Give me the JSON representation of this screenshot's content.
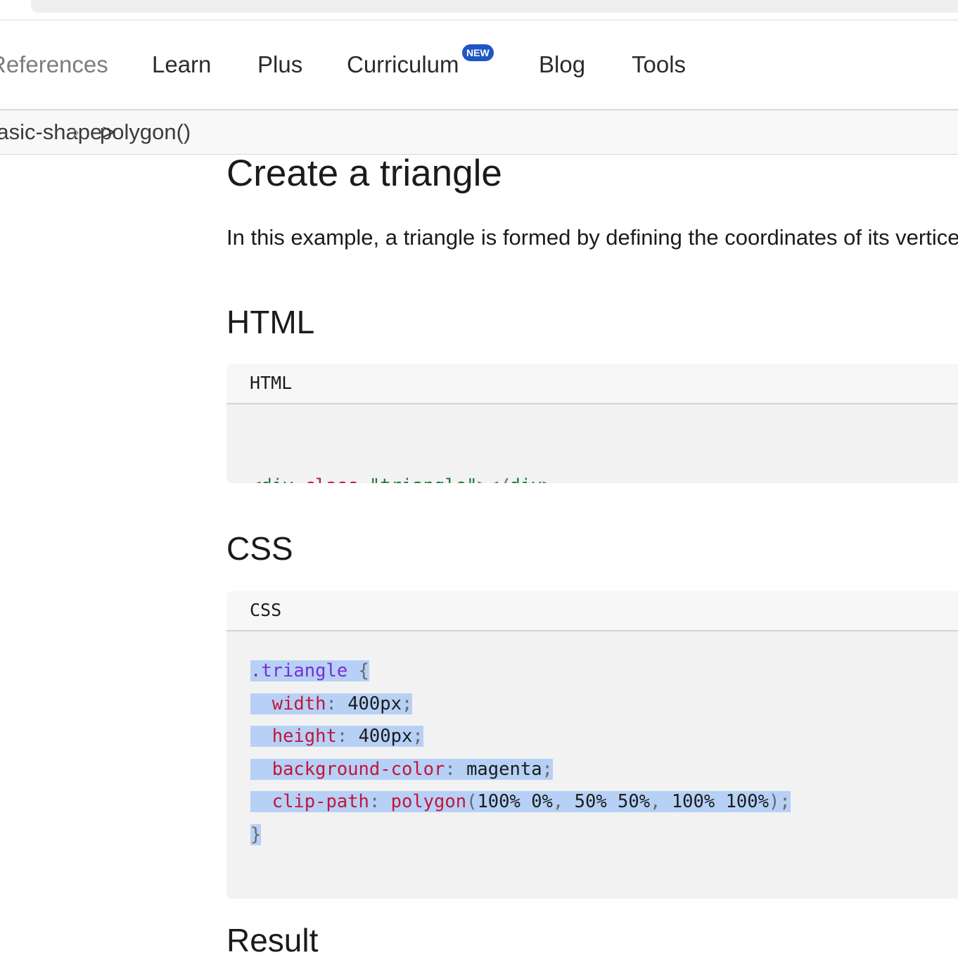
{
  "address_bar": {},
  "nav": {
    "items": [
      "References",
      "Learn",
      "Plus",
      "Curriculum",
      "Blog",
      "Tools"
    ],
    "curriculum_badge": "NEW"
  },
  "breadcrumb": {
    "parent": "<basic-shape>",
    "current": "polygon()",
    "separator": "›"
  },
  "content": {
    "heading": "Create a triangle",
    "intro": "In this example, a triangle is formed by defining the coordinates of its vertices.",
    "html_heading": "HTML",
    "html_block": {
      "lang_label": "HTML",
      "code": {
        "open": "<",
        "tag": "div",
        "attr": "class",
        "eq": "=",
        "value": "\"triangle\"",
        "close": "></",
        "end": ">"
      }
    },
    "css_heading": "CSS",
    "css_block": {
      "lang_label": "CSS",
      "selector": ".triangle",
      "open_brace": "{",
      "close_brace": "}",
      "colon": ":",
      "semicolon": ";",
      "decls": [
        {
          "prop": "width",
          "value": "400px"
        },
        {
          "prop": "height",
          "value": "400px"
        },
        {
          "prop": "background-color",
          "value": "magenta"
        }
      ],
      "clip": {
        "prop": "clip-path",
        "fn": "polygon",
        "lparen": "(",
        "rparen": ")",
        "comma": ",",
        "points": [
          "100% 0%",
          "50% 50%",
          "100% 100%"
        ]
      }
    },
    "result_heading": "Result"
  },
  "colors": {
    "badge": "#1f56c6",
    "selection": "#b6d1f5",
    "code_bg": "#f2f2f2",
    "token_property": "#c4153c",
    "token_selector": "#7a2cd9",
    "token_string": "#1e7a34"
  }
}
